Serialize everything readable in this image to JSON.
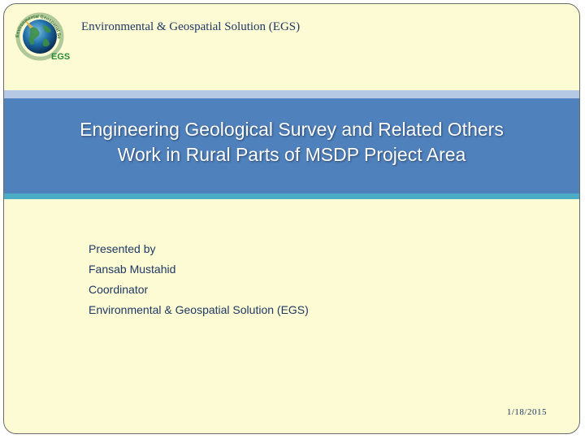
{
  "header": {
    "org_name": "Environmental & Geospatial Solution (EGS)",
    "logo_text": "EGS",
    "logo_ring_text": "Environmental Geospatial Solution"
  },
  "title": {
    "line1": "Engineering Geological Survey and Related Others",
    "line2": "Work in Rural Parts of MSDP Project Area"
  },
  "presenter": {
    "line1": "Presented by",
    "line2": "Fansab Mustahid",
    "line3": "Coordinator",
    "line4": "Environmental & Geospatial Solution (EGS)"
  },
  "footer": {
    "date": "1/18/2015"
  },
  "colors": {
    "background": "#fdfbd3",
    "title_band": "#4f81bd",
    "accent_teal": "#4bacc6",
    "text_dark_blue": "#1f3864",
    "logo_green": "#2e8b3a"
  },
  "icons": {
    "logo": "globe-logo-icon"
  }
}
